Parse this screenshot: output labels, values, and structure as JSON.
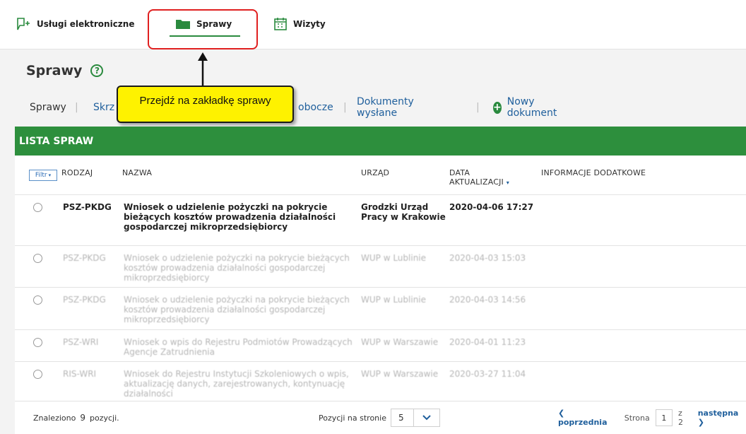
{
  "topnav": {
    "uslugi": "Usługi elektroniczne",
    "sprawy": "Sprawy",
    "wizyty": "Wizyty"
  },
  "page": {
    "title": "Sprawy",
    "help": "?"
  },
  "callout": "Przejdź na zakładkę sprawy",
  "subnav": {
    "sprawy": "Sprawy",
    "skr": "Skrz",
    "robocze": "obocze",
    "wyslane": "Dokumenty wysłane",
    "nowy": "Nowy dokument",
    "sep": "|"
  },
  "list": {
    "title": "LISTA SPRAW",
    "filter": "Filtr",
    "columns": {
      "rodzaj": "RODZAJ",
      "nazwa": "NAZWA",
      "urzad": "URZĄD",
      "data_line1": "DATA",
      "data_line2": "AKTUALIZACJI",
      "info": "INFORMACJE DODATKOWE"
    },
    "rows": [
      {
        "rodzaj": "PSZ-PKDG",
        "nazwa": "Wniosek o udzielenie pożyczki na pokrycie bieżących kosztów prowadzenia działalności gospodarczej mikroprzedsiębiorcy",
        "urzad": "Grodzki Urząd Pracy w Krakowie",
        "data": "2020-04-06 17:27"
      },
      {
        "rodzaj": "PSZ-PKDG",
        "nazwa": "Wniosek o udzielenie pożyczki na pokrycie bieżących kosztów prowadzenia działalności gospodarczej mikroprzedsiębiorcy",
        "urzad": "WUP w Lublinie",
        "data": "2020-04-03 15:03"
      },
      {
        "rodzaj": "PSZ-PKDG",
        "nazwa": "Wniosek o udzielenie pożyczki na pokrycie bieżących kosztów prowadzenia działalności gospodarczej mikroprzedsiębiorcy",
        "urzad": "WUP w Lublinie",
        "data": "2020-04-03 14:56"
      },
      {
        "rodzaj": "PSZ-WRI",
        "nazwa": "Wniosek o wpis do Rejestru Podmiotów Prowadzących Agencje Zatrudnienia",
        "urzad": "WUP w Warszawie",
        "data": "2020-04-01 11:23"
      },
      {
        "rodzaj": "RIS-WRI",
        "nazwa": "Wniosek do Rejestru Instytucji Szkoleniowych o wpis, aktualizację danych, zarejestrowanych, kontynuację działalności",
        "urzad": "WUP w Warszawie",
        "data": "2020-03-27 11:04"
      }
    ]
  },
  "footer": {
    "found_prefix": "Znaleziono",
    "found_count": "9",
    "found_suffix": "pozycji.",
    "per_page_label": "Pozycji na stronie",
    "per_page_value": "5",
    "prev": "poprzednia",
    "page_label": "Strona",
    "page_value": "1",
    "of": "z 2",
    "next": "następna"
  },
  "colors": {
    "accent": "#2d8f3d",
    "link": "#1f5f9c",
    "callout": "#fef200",
    "highlight": "#e02020"
  }
}
